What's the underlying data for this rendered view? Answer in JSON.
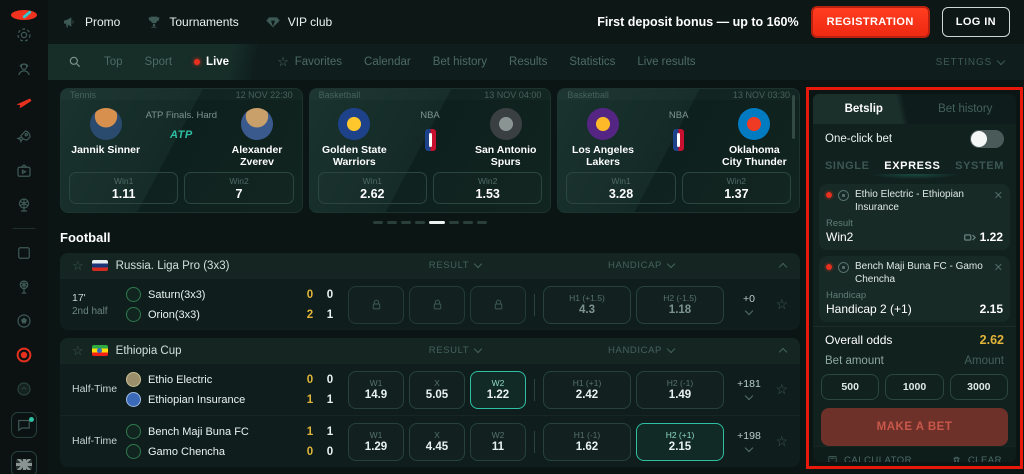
{
  "topbar": {
    "menu": [
      {
        "label": "Promo"
      },
      {
        "label": "Tournaments"
      },
      {
        "label": "VIP club"
      }
    ],
    "bonus_text": "First deposit bonus — up to 160%",
    "registration": "REGISTRATION",
    "login": "LOG IN"
  },
  "nav": {
    "tabs_left": [
      {
        "label": "Top"
      },
      {
        "label": "Sport"
      },
      {
        "label": "Live"
      }
    ],
    "tabs_right": [
      {
        "label": "Favorites"
      },
      {
        "label": "Calendar"
      },
      {
        "label": "Bet history"
      },
      {
        "label": "Results"
      },
      {
        "label": "Statistics"
      },
      {
        "label": "Live results"
      }
    ],
    "settings": "SETTINGS"
  },
  "sidebar_icons": [
    "casino",
    "live-dealer",
    "aviator",
    "rocket-games",
    "tv-games",
    "wheel-of-fortune",
    "slots",
    "virtual-sports",
    "football",
    "live-bets",
    "esports",
    "support-chat",
    "language-english"
  ],
  "cards": [
    {
      "sport": "Tennis",
      "datetime": "12 NOV 22:30",
      "league": "ATP Finals. Hard",
      "badge": "ATP",
      "home": "Jannik Sinner",
      "away": "Alexander Zverev",
      "odd1_label": "Win1",
      "odd1": "1.11",
      "odd2_label": "Win2",
      "odd2": "7"
    },
    {
      "sport": "Basketball",
      "datetime": "13 NOV 04:00",
      "league": "NBA",
      "badge": "NBA",
      "home": "Golden State Warriors",
      "away": "San Antonio Spurs",
      "odd1_label": "Win1",
      "odd1": "2.62",
      "odd2_label": "Win2",
      "odd2": "1.53"
    },
    {
      "sport": "Basketball",
      "datetime": "13 NOV 03:30",
      "league": "NBA",
      "badge": "NBA",
      "home": "Los Angeles Lakers",
      "away": "Oklahoma City Thunder",
      "odd1_label": "Win1",
      "odd1": "3.28",
      "odd2_label": "Win2",
      "odd2": "1.37"
    }
  ],
  "section_title": "Football",
  "leagues": [
    {
      "name": "Russia. Liga Pro (3x3)",
      "market1": "RESULT",
      "market2": "HANDICAP",
      "rows": [
        {
          "time": "17'",
          "period": "2nd half",
          "home": "Saturn(3x3)",
          "away": "Orion(3x3)",
          "home_s1": "0",
          "home_s2": "0",
          "away_s1": "2",
          "away_s2": "1",
          "cells": [
            {
              "label": "",
              "value": ""
            },
            {
              "label": "",
              "value": ""
            },
            {
              "label": "",
              "value": ""
            },
            {
              "label": "H1 (+1.5)",
              "value": "4.3"
            },
            {
              "label": "H2 (-1.5)",
              "value": "1.18"
            }
          ],
          "more": "+0"
        }
      ]
    },
    {
      "name": "Ethiopia Cup",
      "market1": "RESULT",
      "market2": "HANDICAP",
      "rows": [
        {
          "time": "Half-Time",
          "period": "",
          "home": "Ethio Electric",
          "away": "Ethiopian Insurance",
          "home_s1": "0",
          "home_s2": "0",
          "away_s1": "1",
          "away_s2": "1",
          "cells": [
            {
              "label": "W1",
              "value": "14.9"
            },
            {
              "label": "X",
              "value": "5.05"
            },
            {
              "label": "W2",
              "value": "1.22"
            },
            {
              "label": "H1 (+1)",
              "value": "2.42"
            },
            {
              "label": "H2 (-1)",
              "value": "1.49"
            }
          ],
          "more": "+181"
        },
        {
          "time": "Half-Time",
          "period": "",
          "home": "Bench Maji Buna FC",
          "away": "Gamo Chencha",
          "home_s1": "1",
          "home_s2": "1",
          "away_s1": "0",
          "away_s2": "0",
          "cells": [
            {
              "label": "W1",
              "value": "1.29"
            },
            {
              "label": "X",
              "value": "4.45"
            },
            {
              "label": "W2",
              "value": "11"
            },
            {
              "label": "H1 (-1)",
              "value": "1.62"
            },
            {
              "label": "H2 (+1)",
              "value": "2.15"
            }
          ],
          "more": "+198"
        }
      ]
    }
  ],
  "betslip": {
    "tab_betslip": "Betslip",
    "tab_history": "Bet history",
    "one_click": "One-click bet",
    "type_single": "SINGLE",
    "type_express": "EXPRESS",
    "type_system": "SYSTEM",
    "bets": [
      {
        "match": "Ethio Electric - Ethiopian Insurance",
        "market": "Result",
        "pick": "Win2",
        "odds": "1.22"
      },
      {
        "match": "Bench Maji Buna FC - Gamo Chencha",
        "market": "Handicap",
        "pick": "Handicap 2 (+1)",
        "odds": "2.15"
      }
    ],
    "overall_label": "Overall odds",
    "overall_odds": "2.62",
    "amount_label": "Bet amount",
    "amount_placeholder": "Amount",
    "quick": [
      "500",
      "1000",
      "3000"
    ],
    "make_bet": "MAKE A BET",
    "calculator": "CALCULATOR",
    "clear": "CLEAR"
  }
}
